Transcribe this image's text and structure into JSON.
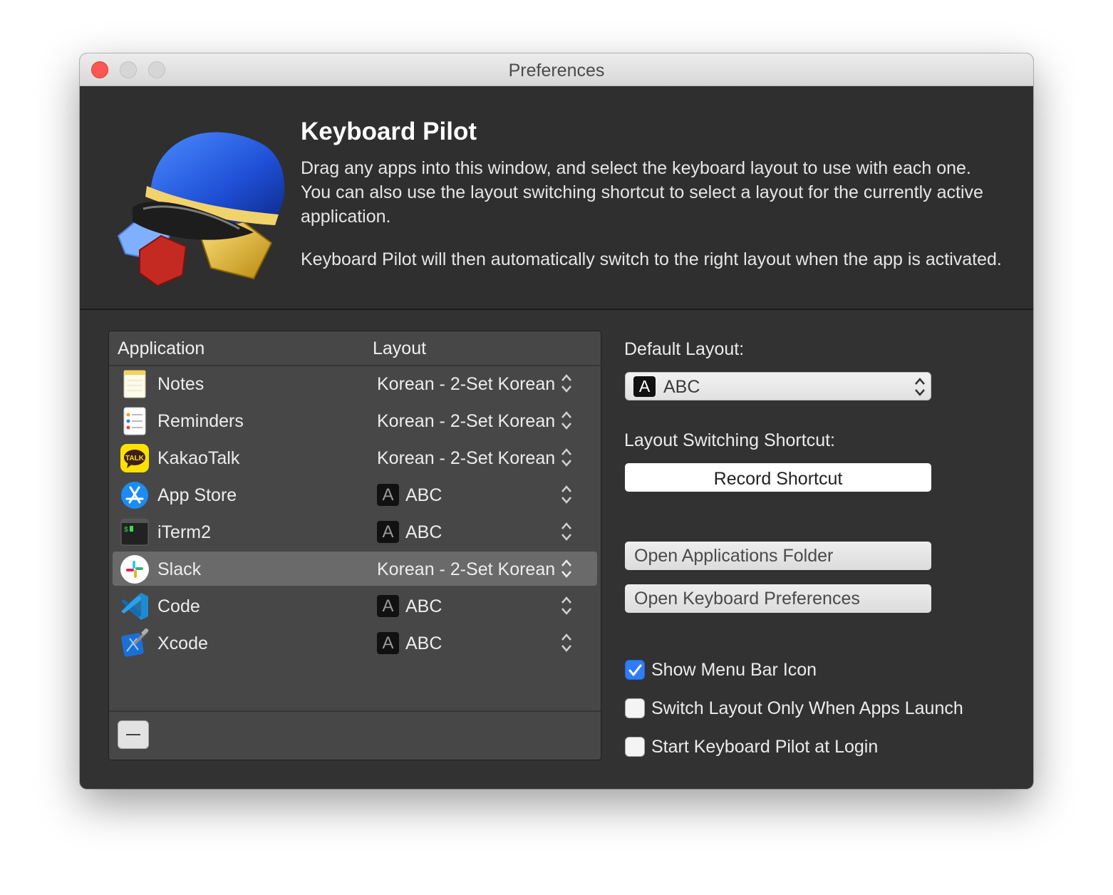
{
  "window": {
    "title": "Preferences"
  },
  "header": {
    "app_name": "Keyboard Pilot",
    "description_1": "Drag any apps into this window, and select the keyboard layout to use with each one. You can also use the layout switching shortcut to select a layout for the currently active application.",
    "description_2": "Keyboard Pilot will then automatically switch to the right layout when the app is activated."
  },
  "table": {
    "columns": {
      "application": "Application",
      "layout": "Layout"
    },
    "abc_badge": "A",
    "rows": [
      {
        "name": "Notes",
        "layout": "Korean - 2-Set Korean",
        "icon": "notes-icon"
      },
      {
        "name": "Reminders",
        "layout": "Korean - 2-Set Korean",
        "icon": "reminders-icon"
      },
      {
        "name": "KakaoTalk",
        "layout": "Korean - 2-Set Korean",
        "icon": "kakaotalk-icon"
      },
      {
        "name": "App Store",
        "layout": "ABC",
        "icon": "app-store-icon"
      },
      {
        "name": "iTerm2",
        "layout": "ABC",
        "icon": "iterm2-icon"
      },
      {
        "name": "Slack",
        "layout": "Korean - 2-Set Korean",
        "icon": "slack-icon",
        "selected": true
      },
      {
        "name": "Code",
        "layout": "ABC",
        "icon": "vscode-icon"
      },
      {
        "name": "Xcode",
        "layout": "ABC",
        "icon": "xcode-icon"
      }
    ]
  },
  "settings": {
    "default_layout_label": "Default Layout:",
    "default_layout_badge": "A",
    "default_layout_value": "ABC",
    "shortcut_label": "Layout Switching Shortcut:",
    "record_shortcut": "Record Shortcut",
    "open_apps_folder": "Open Applications Folder",
    "open_keyboard_prefs": "Open Keyboard Preferences",
    "show_menu_bar_icon": "Show Menu Bar Icon",
    "switch_only_on_launch": "Switch Layout Only When Apps Launch",
    "start_at_login": "Start Keyboard Pilot at Login",
    "show_menu_bar_icon_checked": true,
    "switch_only_on_launch_checked": false,
    "start_at_login_checked": false
  },
  "colors": {
    "accent": "#2f7cf6",
    "close": "#fc5753",
    "window_bg": "#323232"
  }
}
